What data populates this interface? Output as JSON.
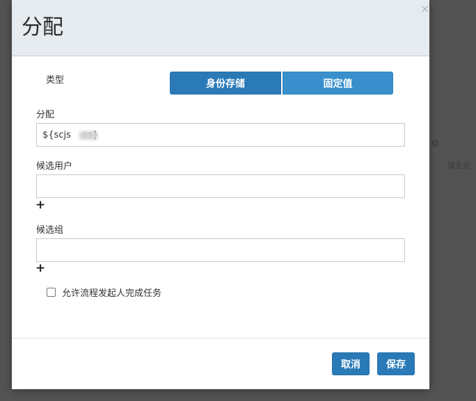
{
  "background": {
    "partial_label": "请先完"
  },
  "dialog": {
    "title": "分配",
    "close_glyph": "×",
    "type_label": "类型",
    "type_options": {
      "identity_store": "身份存储",
      "fixed_value": "固定值"
    },
    "assignee": {
      "label": "分配",
      "value": "${scjs    es}"
    },
    "candidate_users": {
      "label": "候选用户",
      "value": "",
      "add_glyph": "+"
    },
    "candidate_groups": {
      "label": "候选组",
      "value": "",
      "add_glyph": "+"
    },
    "initiator_checkbox": {
      "label": "允许流程发起人完成任务",
      "checked": false
    },
    "buttons": {
      "cancel": "取消",
      "save": "保存"
    }
  },
  "colors": {
    "primary": "#2a7ab7",
    "secondary_segment": "#3990cc",
    "header_bg": "#e6ebef"
  }
}
